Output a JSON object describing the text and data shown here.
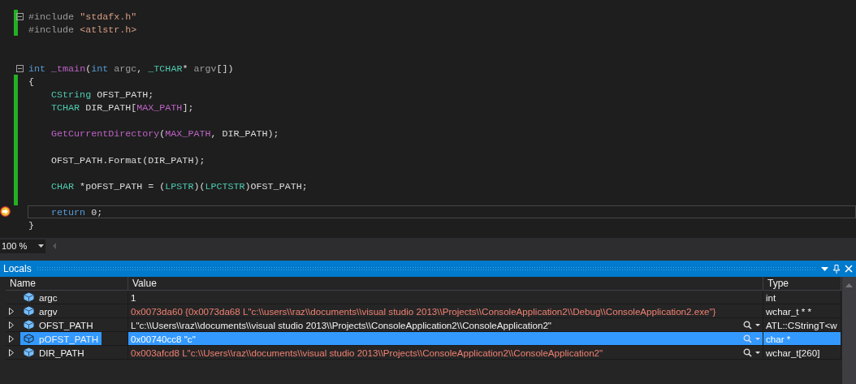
{
  "editor": {
    "lines": [
      {
        "tokens": [
          {
            "kind": "preproc",
            "text": "#include "
          },
          {
            "kind": "string",
            "text": "\"stdafx.h\""
          }
        ],
        "changed": true,
        "fold": true,
        "current": false
      },
      {
        "tokens": [
          {
            "kind": "preproc",
            "text": "#include "
          },
          {
            "kind": "string",
            "text": "<atlstr.h>"
          }
        ],
        "changed": true,
        "fold": false,
        "current": false
      },
      {
        "changed": false,
        "fold": false,
        "current": false
      },
      {
        "changed": false,
        "fold": false,
        "current": false
      },
      {
        "tokens": [
          {
            "kind": "keyword",
            "text": "int"
          },
          {
            "kind": "macro",
            "text": " _tmain"
          },
          {
            "kind": "plain",
            "text": "("
          },
          {
            "kind": "keyword",
            "text": "int"
          },
          {
            "kind": "param",
            "text": " argc"
          },
          {
            "kind": "plain",
            "text": ", "
          },
          {
            "kind": "type",
            "text": "_TCHAR"
          },
          {
            "kind": "plain",
            "text": "* "
          },
          {
            "kind": "param",
            "text": "argv"
          },
          {
            "kind": "plain",
            "text": "[])"
          }
        ],
        "changed": false,
        "fold": true,
        "current": false
      },
      {
        "tokens": [
          {
            "kind": "plain",
            "text": "{"
          }
        ],
        "changed": true,
        "fold": false,
        "current": false
      },
      {
        "tokens": [
          {
            "kind": "type",
            "text": "    CString"
          },
          {
            "kind": "plain",
            "text": " OFST_PATH;"
          }
        ],
        "changed": true,
        "fold": false,
        "current": false
      },
      {
        "tokens": [
          {
            "kind": "type",
            "text": "    TCHAR"
          },
          {
            "kind": "plain",
            "text": " DIR_PATH["
          },
          {
            "kind": "macro",
            "text": "MAX_PATH"
          },
          {
            "kind": "plain",
            "text": "];"
          }
        ],
        "changed": true,
        "fold": false,
        "current": false
      },
      {
        "changed": true,
        "fold": false,
        "current": false
      },
      {
        "tokens": [
          {
            "kind": "macro",
            "text": "    GetCurrentDirectory"
          },
          {
            "kind": "plain",
            "text": "("
          },
          {
            "kind": "macro",
            "text": "MAX_PATH"
          },
          {
            "kind": "plain",
            "text": ", DIR_PATH);"
          }
        ],
        "changed": true,
        "fold": false,
        "current": false
      },
      {
        "changed": true,
        "fold": false,
        "current": false
      },
      {
        "tokens": [
          {
            "kind": "plain",
            "text": "    OFST_PATH.Format(DIR_PATH);"
          }
        ],
        "changed": true,
        "fold": false,
        "current": false
      },
      {
        "changed": true,
        "fold": false,
        "current": false
      },
      {
        "tokens": [
          {
            "kind": "type",
            "text": "    CHAR"
          },
          {
            "kind": "plain",
            "text": " *pOFST_PATH = ("
          },
          {
            "kind": "type",
            "text": "LPSTR"
          },
          {
            "kind": "plain",
            "text": ")("
          },
          {
            "kind": "type",
            "text": "LPCTSTR"
          },
          {
            "kind": "plain",
            "text": ")OFST_PATH;"
          }
        ],
        "changed": true,
        "fold": false,
        "current": false
      },
      {
        "changed": true,
        "fold": false,
        "current": false
      },
      {
        "tokens": [
          {
            "kind": "keyword",
            "text": "    return"
          },
          {
            "kind": "plain",
            "text": " 0;"
          }
        ],
        "changed": false,
        "fold": false,
        "current": true
      },
      {
        "tokens": [
          {
            "kind": "plain",
            "text": "}"
          }
        ],
        "changed": false,
        "fold": false,
        "current": false
      }
    ]
  },
  "zoom": {
    "value": "100 %"
  },
  "locals": {
    "title": "Locals",
    "columns": [
      "Name",
      "Value",
      "Type"
    ],
    "rows": [
      {
        "name": "argc",
        "value": "1",
        "type": "int",
        "expandable": false,
        "selected": false,
        "changed": false,
        "visualizer": false
      },
      {
        "name": "argv",
        "value": "0x0073da60 {0x0073da68 L\"c:\\\\users\\\\raz\\\\documents\\\\visual studio 2013\\\\Projects\\\\ConsoleApplication2\\\\Debug\\\\ConsoleApplication2.exe\"}",
        "type": "wchar_t * *",
        "expandable": true,
        "selected": false,
        "changed": true,
        "visualizer": false
      },
      {
        "name": "OFST_PATH",
        "value": "L\"c:\\\\Users\\\\raz\\\\documents\\\\visual studio 2013\\\\Projects\\\\ConsoleApplication2\\\\ConsoleApplication2\"",
        "type": "ATL::CStringT<w",
        "expandable": true,
        "selected": false,
        "changed": false,
        "visualizer": true
      },
      {
        "name": "pOFST_PATH",
        "value": "0x00740cc8 \"c\"",
        "type": "char *",
        "expandable": true,
        "selected": true,
        "changed": false,
        "visualizer": true
      },
      {
        "name": "DIR_PATH",
        "value": "0x003afcd8 L\"c:\\\\Users\\\\raz\\\\documents\\\\visual studio 2013\\\\Projects\\\\ConsoleApplication2\\\\ConsoleApplication2\"",
        "type": "wchar_t[260]",
        "expandable": true,
        "selected": false,
        "changed": true,
        "visualizer": true
      }
    ]
  }
}
